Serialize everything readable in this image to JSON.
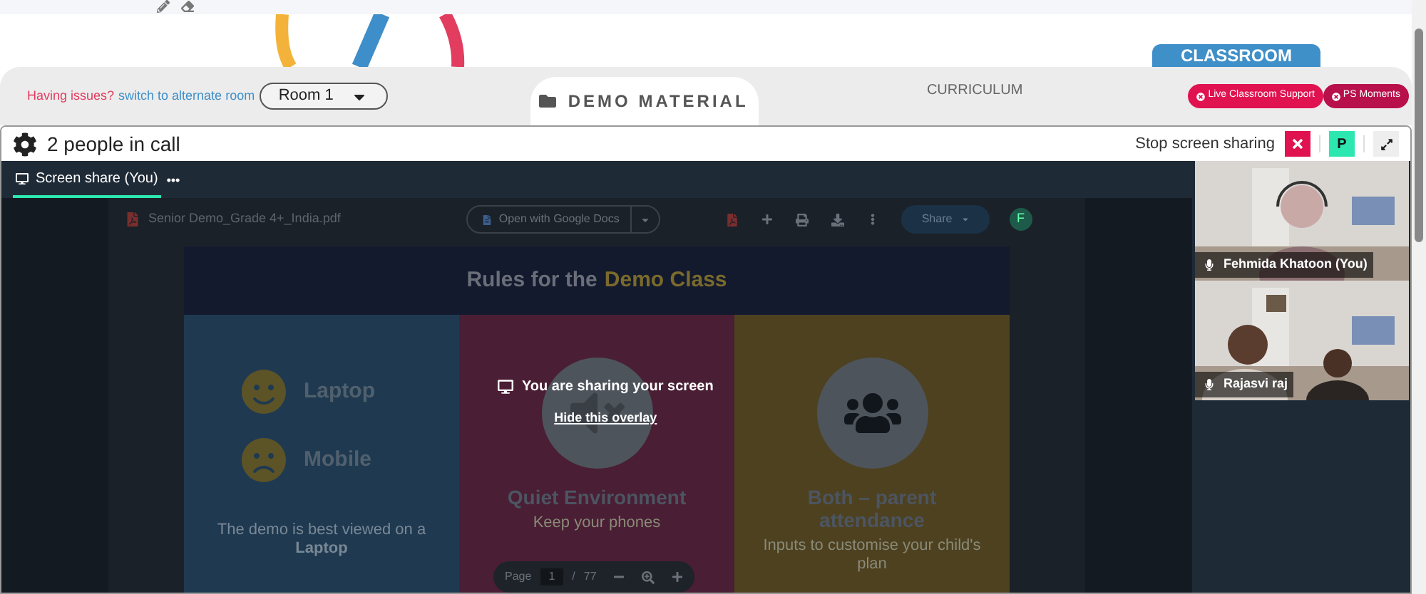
{
  "room_bar": {
    "issues_text": "Having issues?",
    "alternate_link": "switch to alternate room",
    "room_select": "Room 1",
    "tabs": [
      {
        "label": "DEMO MATERIAL",
        "selected": true
      },
      {
        "label": "CURRICULUM",
        "selected": false
      }
    ],
    "classroom_label": "CLASSROOM",
    "buttons": [
      "Live Classroom Support",
      "PS Moments"
    ]
  },
  "call": {
    "title": "2 people in call",
    "stop_sharing": "Stop screen sharing",
    "avatar_letter": "P",
    "tab": {
      "label": "Screen share (You)",
      "selected": true
    },
    "pdf": {
      "file_name": "Senior Demo_Grade 4+_India.pdf",
      "open_with": "Open with Google Docs",
      "share": "Share",
      "avatar_letter": "F",
      "slide": {
        "title": "Rules for the",
        "title_highlight": "Demo Class",
        "columns": [
          {
            "kind": "devices",
            "color": "#1f3a50",
            "items": [
              {
                "label": "Laptop"
              },
              {
                "label": "Mobile"
              }
            ],
            "caption": "The demo is best viewed on a **Laptop**"
          },
          {
            "kind": "mute",
            "color": "#4a1e34",
            "heading": "Quiet Environment",
            "caption": "Keep your phones"
          },
          {
            "kind": "family",
            "color": "#4d4120",
            "heading": "Both – parent attendance",
            "caption": "Inputs to customise your child's plan"
          }
        ]
      },
      "pager": {
        "label": "Page",
        "current": "1",
        "separator": "/",
        "total": "77"
      }
    },
    "overlay": {
      "message": "You are sharing your screen",
      "hide_link": "Hide this overlay"
    },
    "videos": [
      {
        "name": "Fehmida Khatoon (You)"
      },
      {
        "name": "Rajasvi raj"
      }
    ]
  }
}
